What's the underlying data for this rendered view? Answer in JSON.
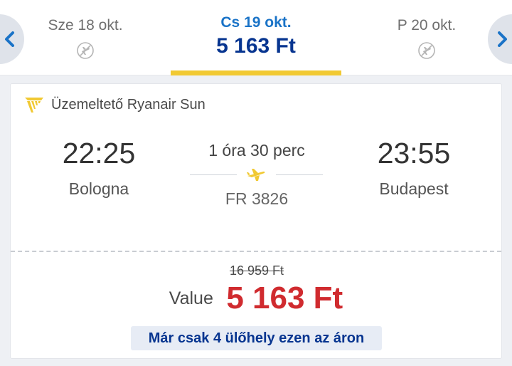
{
  "date_selector": {
    "prev_icon": "chevron-left-icon",
    "next_icon": "chevron-right-icon",
    "dates": [
      {
        "label": "Sze 18 okt.",
        "status_icon": "no-flight-icon"
      },
      {
        "label": "Cs 19 okt.",
        "price": "5 163 Ft",
        "selected": true
      },
      {
        "label": "P 20 okt.",
        "status_icon": "no-flight-icon"
      }
    ],
    "accent_color": "#f1c933"
  },
  "flight": {
    "operator": "Üzemeltető Ryanair Sun",
    "operator_icon": "ryanair-harp-logo",
    "departure": {
      "time": "22:25",
      "city": "Bologna"
    },
    "arrival": {
      "time": "23:55",
      "city": "Budapest"
    },
    "duration": "1 óra 30 perc",
    "flight_number": "FR 3826",
    "route_icon": "plane-icon"
  },
  "fare": {
    "original_price": "16 959 Ft",
    "type": "Value",
    "price": "5 163 Ft",
    "seats_notice": "Már csak 4 ülőhely ezen az áron",
    "price_color": "#d02b2f"
  }
}
